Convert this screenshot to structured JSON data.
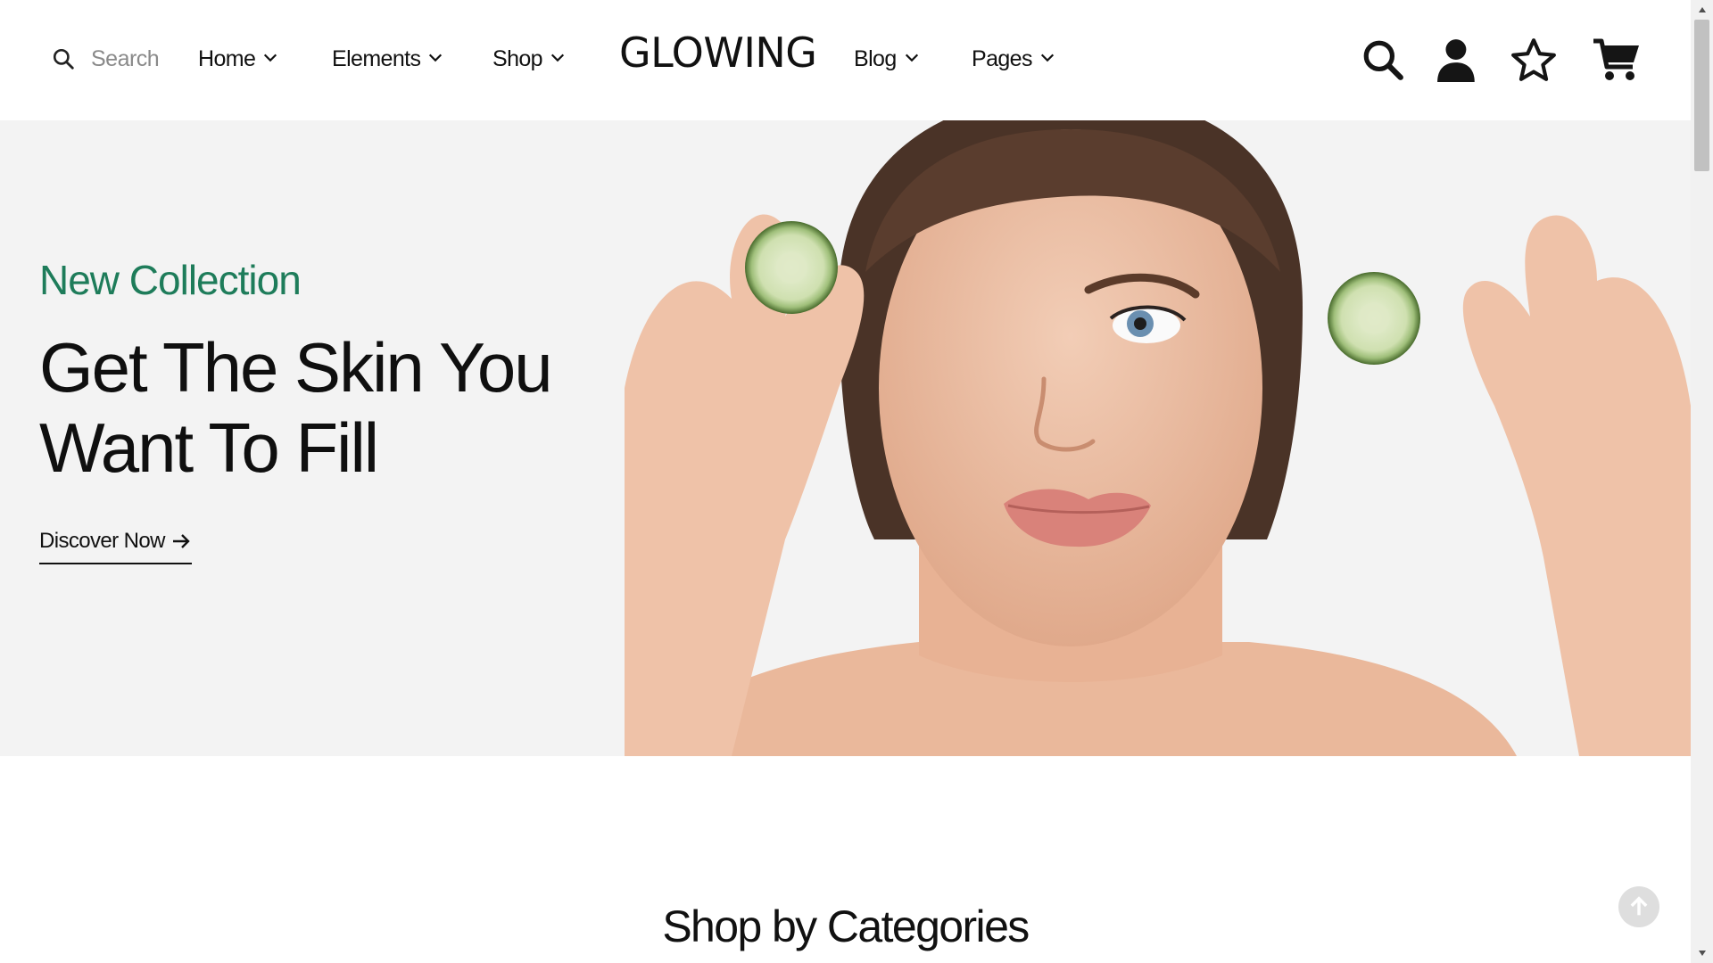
{
  "header": {
    "search_label": "Search",
    "logo": "GLOWING",
    "nav": [
      {
        "label": "Home"
      },
      {
        "label": "Elements"
      },
      {
        "label": "Shop"
      },
      {
        "label": "Blog"
      },
      {
        "label": "Pages"
      }
    ],
    "icons": [
      "search-icon",
      "user-icon",
      "star-icon",
      "cart-icon"
    ]
  },
  "hero": {
    "eyebrow": "New Collection",
    "headline": "Get The Skin You Want To Fill",
    "cta_label": "Discover Now",
    "image_subject": "woman-holding-cucumber-slices"
  },
  "sections": {
    "categories_title": "Shop by Categories"
  },
  "colors": {
    "accent": "#1e7c5a",
    "hero_bg": "#f3f3f3",
    "text": "#111111"
  }
}
